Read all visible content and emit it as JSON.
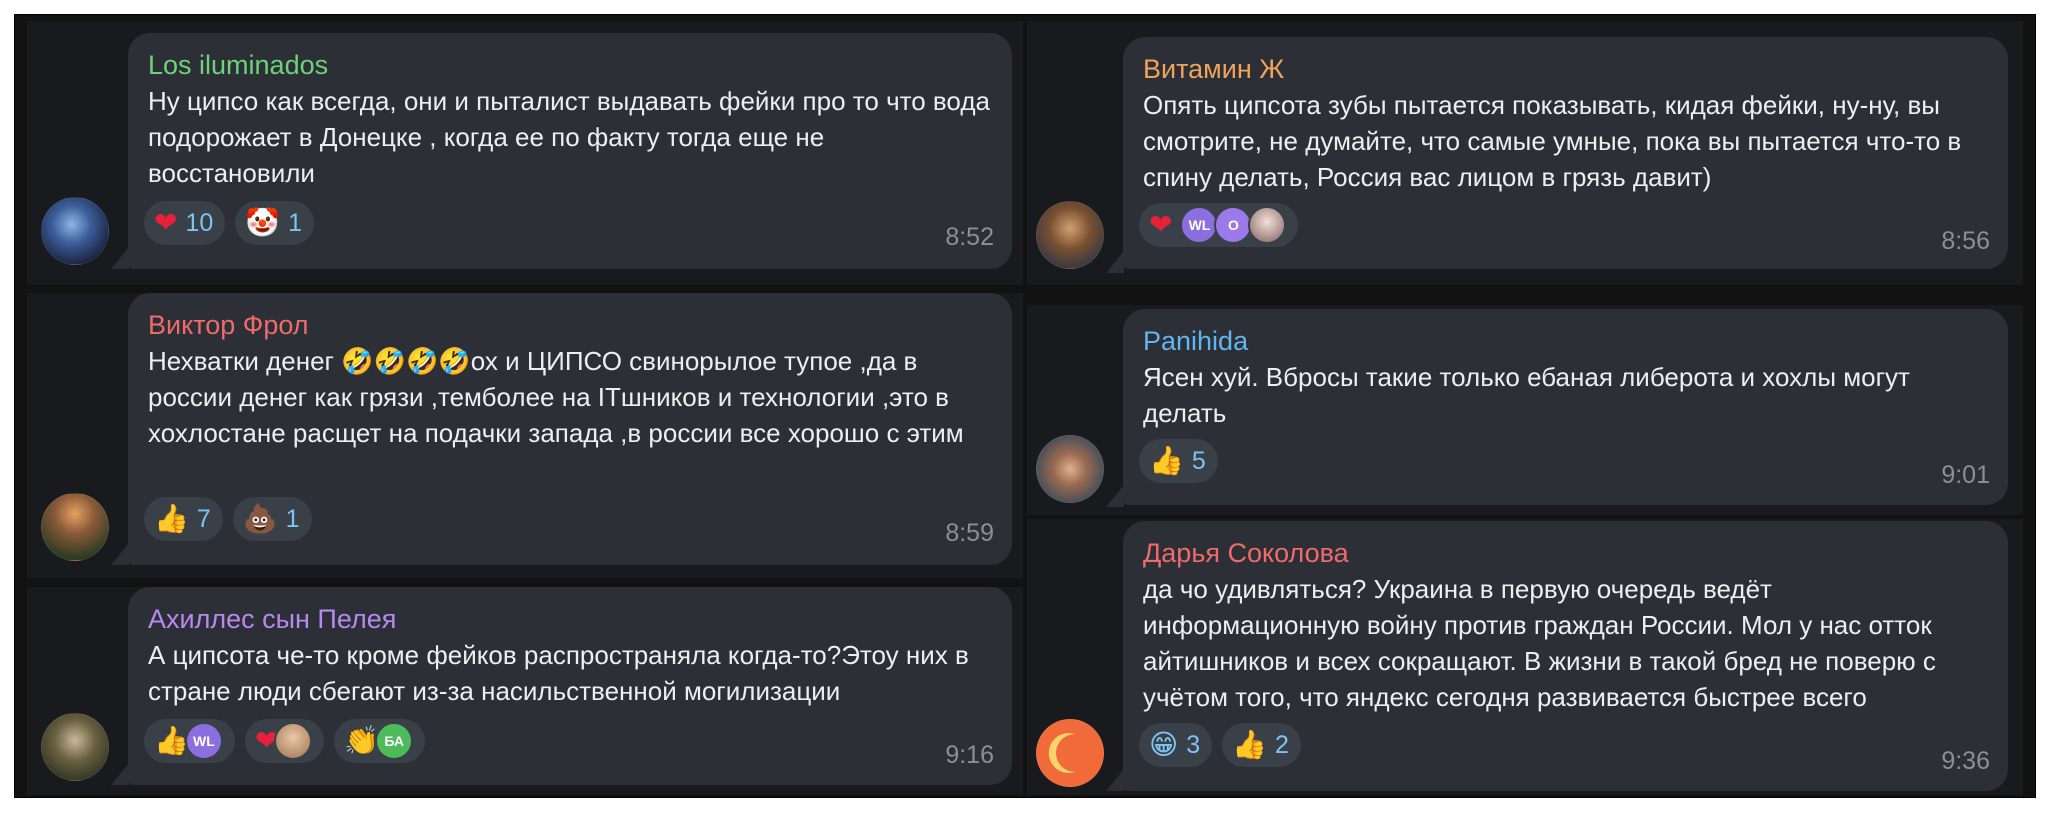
{
  "colors": {
    "bubble": "#2c2f35",
    "reaction_count": "#7ec3f3",
    "green_name": "#6fd17a",
    "orange_name": "#f0a35a",
    "red_name": "#ee6b6b",
    "blue_name": "#62b6ee",
    "purple_name": "#b789f0"
  },
  "left": [
    {
      "author": "Los iluminados",
      "text": "Ну ципсо как всегда, они и пыталист выдавать фейки про то что вода подорожает в Донецке , когда ее по факту тогда еще не восстановили",
      "time": "8:52",
      "reactions": [
        {
          "icon": "heart",
          "count": "10"
        },
        {
          "icon": "clown",
          "count": "1"
        }
      ]
    },
    {
      "author": "Виктор Фрол",
      "text": "Нехватки денег 🤣🤣🤣🤣ох и ЦИПСО свинорылое тупое ,да в россии денег как грязи ,темболее на ITшников и технологии ,это в хохлостане расщет на подачки запада ,в россии все хорошо с этим",
      "time": "8:59",
      "reactions": [
        {
          "icon": "thumbs-up",
          "count": "7"
        },
        {
          "icon": "poop",
          "count": "1"
        }
      ]
    },
    {
      "author": "Ахиллес сын Пелея",
      "text": "А ципсота че-то кроме фейков распространяла когда-то?Этоу них в стране люди сбегают из-за насильственной могилизации",
      "time": "9:16",
      "reactions": [
        {
          "icon": "thumbs-up",
          "avatars": [
            "WL"
          ]
        },
        {
          "icon": "heart",
          "avatars": [
            ""
          ]
        },
        {
          "icon": "clap",
          "avatars": [
            "БА"
          ]
        }
      ]
    }
  ],
  "right": [
    {
      "author": "Витамин Ж",
      "text": "Опять ципсота зубы пытается показывать, кидая фейки, ну-ну, вы смотрите, не думайте, что самые умные, пока вы пытается что-то в спину делать, Россия вас лицом в грязь давит)",
      "time": "8:56",
      "reactions": [
        {
          "icon": "heart",
          "avatars": [
            "WL",
            "O",
            ""
          ]
        }
      ]
    },
    {
      "author": "Panihida",
      "text": "Ясен хуй. Вбросы такие только ебаная либерота и хохлы могут делать",
      "time": "9:01",
      "reactions": [
        {
          "icon": "thumbs-up",
          "count": "5"
        }
      ]
    },
    {
      "author": "Дарья Соколова",
      "text": "да чо удивляться? Украина в первую очередь ведёт информационную войну против граждан России. Мол у нас отток айтишников и всех сокращают. В жизни в такой бред не поверю с учётом того, что яндекс сегодня развивается быстрее всего",
      "time": "9:36",
      "reactions": [
        {
          "icon": "grin",
          "count": "3"
        },
        {
          "icon": "thumbs-up",
          "count": "2"
        }
      ]
    }
  ]
}
